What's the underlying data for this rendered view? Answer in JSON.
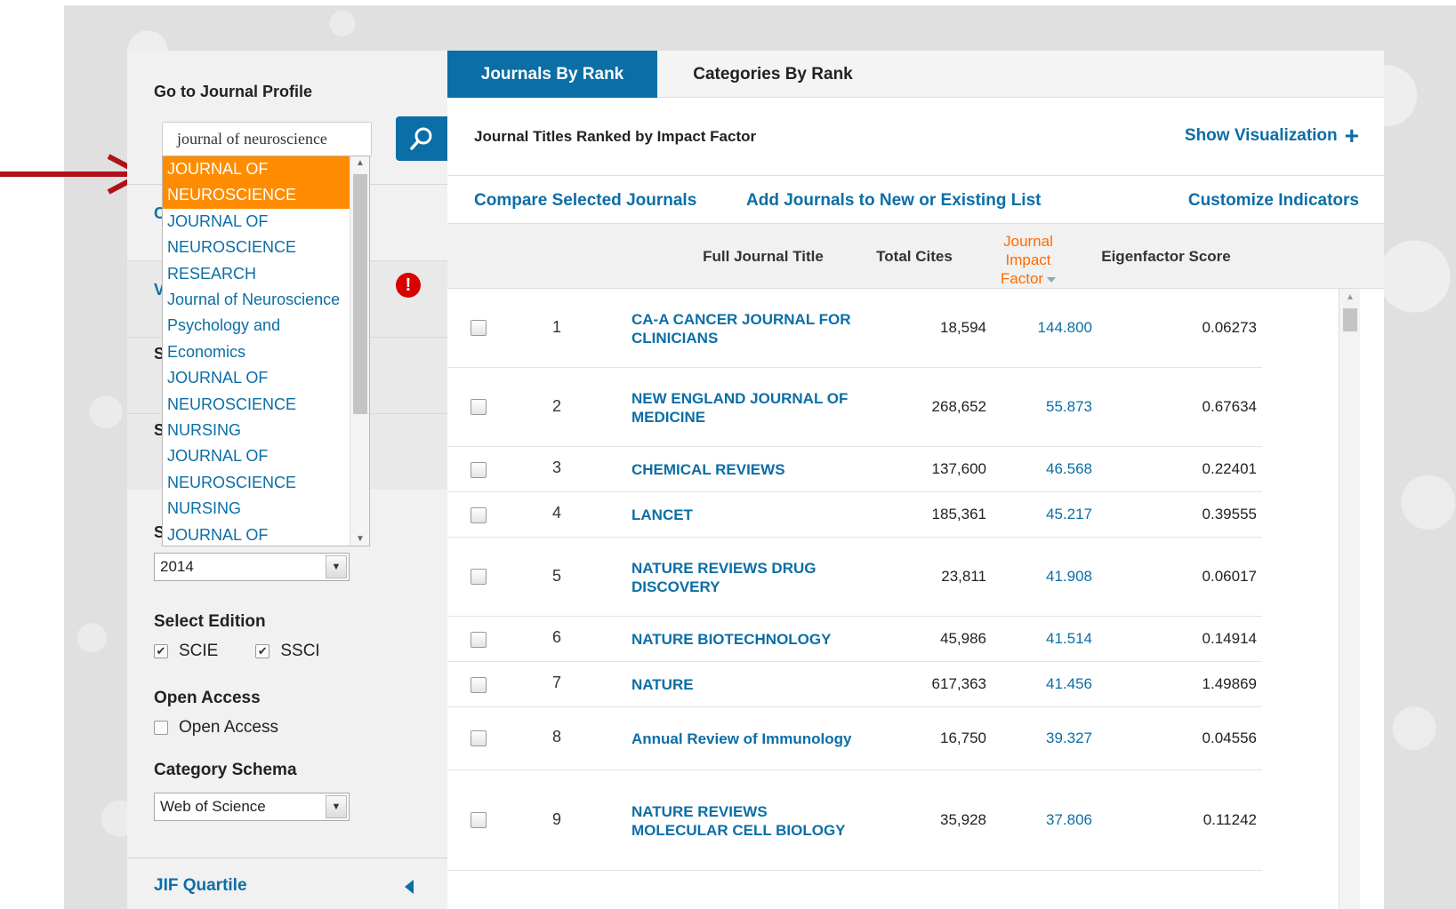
{
  "left_panel": {
    "title": "Go to Journal Profile",
    "search_value": "journal of neuroscience",
    "autocomplete": [
      "JOURNAL OF\nNEUROSCIENCE",
      "JOURNAL OF\nNEUROSCIENCE\nRESEARCH",
      "Journal of Neuroscience\nPsychology and\nEconomics",
      "JOURNAL OF\nNEUROSCIENCE\nNURSING",
      "JOURNAL OF\nNEUROSCIENCE\nNURSING",
      "JOURNAL OF"
    ],
    "hidden_letters": [
      "C",
      "V",
      "S",
      "S",
      "S"
    ],
    "year_label": "2014",
    "edition_label": "Select Edition",
    "editions": [
      "SCIE",
      "SSCI"
    ],
    "open_access_label": "Open Access",
    "open_access_option": "Open Access",
    "schema_label": "Category Schema",
    "schema_value": "Web of Science",
    "jif_quartile": "JIF Quartile",
    "alert_glyph": "!"
  },
  "tabs": [
    "Journals By Rank",
    "Categories By Rank"
  ],
  "subheader": {
    "title": "Journal Titles Ranked by Impact Factor",
    "show_viz": "Show Visualization",
    "plus": "+"
  },
  "actions": [
    "Compare Selected Journals",
    "Add Journals to New or Existing List",
    "Customize Indicators"
  ],
  "table": {
    "headers": {
      "title": "Full Journal Title",
      "cites": "Total Cites",
      "jif": "Journal\nImpact\nFactor",
      "eig": "Eigenfactor Score"
    },
    "rows": [
      {
        "rank": "1",
        "title": "CA-A CANCER JOURNAL FOR\nCLINICIANS",
        "cites": "18,594",
        "jif": "144.800",
        "eig": "0.06273"
      },
      {
        "rank": "2",
        "title": "NEW ENGLAND JOURNAL OF\nMEDICINE",
        "cites": "268,652",
        "jif": "55.873",
        "eig": "0.67634"
      },
      {
        "rank": "3",
        "title": "CHEMICAL REVIEWS",
        "cites": "137,600",
        "jif": "46.568",
        "eig": "0.22401"
      },
      {
        "rank": "4",
        "title": "LANCET",
        "cites": "185,361",
        "jif": "45.217",
        "eig": "0.39555"
      },
      {
        "rank": "5",
        "title": "NATURE REVIEWS DRUG\nDISCOVERY",
        "cites": "23,811",
        "jif": "41.908",
        "eig": "0.06017"
      },
      {
        "rank": "6",
        "title": "NATURE BIOTECHNOLOGY",
        "cites": "45,986",
        "jif": "41.514",
        "eig": "0.14914"
      },
      {
        "rank": "7",
        "title": "NATURE",
        "cites": "617,363",
        "jif": "41.456",
        "eig": "1.49869"
      },
      {
        "rank": "8",
        "title": "Annual Review of Immunology",
        "cites": "16,750",
        "jif": "39.327",
        "eig": "0.04556"
      },
      {
        "rank": "9",
        "title": "NATURE REVIEWS\nMOLECULAR CELL BIOLOGY",
        "cites": "35,928",
        "jif": "37.806",
        "eig": "0.11242"
      }
    ]
  },
  "colors": {
    "accent": "#0b6ea6",
    "highlight": "#ff8c00",
    "alert": "#d90000",
    "arrow": "#b0101a"
  }
}
